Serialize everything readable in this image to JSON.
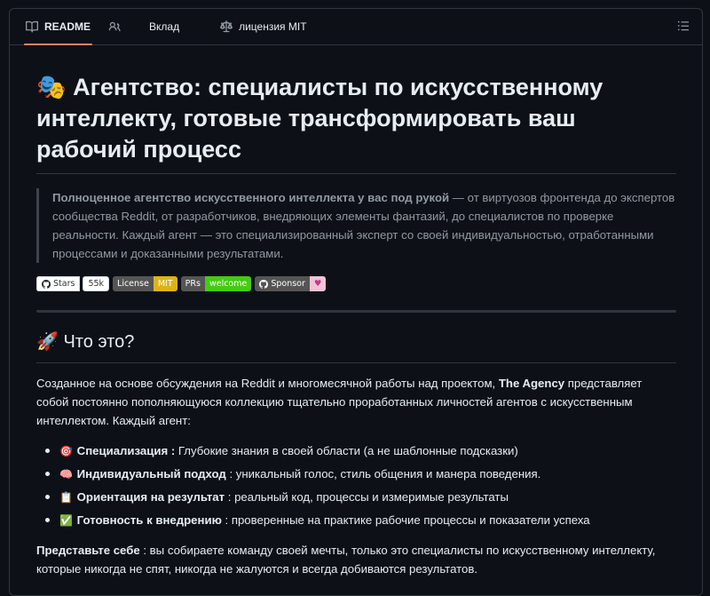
{
  "tabs": [
    {
      "label": "README",
      "icon": "book-icon",
      "active": true
    },
    {
      "label": "",
      "icon": "people-icon"
    },
    {
      "label": "Вклад",
      "icon": ""
    },
    {
      "label": "лицензия MIT",
      "icon": "law-icon"
    }
  ],
  "title": {
    "emoji": "🎭",
    "text": "Агентство: специалисты по искусственному интеллекту, готовые трансформировать ваш рабочий процесс"
  },
  "quote": {
    "bold": "Полноценное агентство искусственного интеллекта у вас под рукой",
    "text": " — от виртуозов фронтенда до экспертов сообщества Reddit, от разработчиков, внедряющих элементы фантазий, до специалистов по проверке реальности. Каждый агент — это специализированный эксперт со своей индивидуальностью, отработанными процессами и доказанными результатами."
  },
  "badges": {
    "stars_label": "Stars",
    "stars_count": "55k",
    "license_label": "License",
    "license_value": "MIT",
    "prs_label": "PRs",
    "prs_value": "welcome",
    "sponsor_label": "Sponsor",
    "sponsor_heart": "♥",
    "colors": {
      "mit": "#dfb317",
      "welcome": "#4c1",
      "heart_bg": "#f0c2d6",
      "heart": "#bf3989"
    }
  },
  "section": {
    "emoji": "🚀",
    "heading": "Что это?",
    "intro_before": "Созданное на основе обсуждения на Reddit и многомесячной работы над проектом, ",
    "intro_bold": "The Agency",
    "intro_after": " представляет собой постоянно пополняющуюся коллекцию тщательно проработанных личностей агентов с искусственным интеллектом. Каждый агент:",
    "items": [
      {
        "emoji": "🎯",
        "bold": "Специализация :",
        "text": " Глубокие знания в своей области (а не шаблонные подсказки)"
      },
      {
        "emoji": "🧠",
        "bold": "Индивидуальный подход",
        "text": " : уникальный голос, стиль общения и манера поведения."
      },
      {
        "emoji": "📋",
        "bold": "Ориентация на результат",
        "text": " : реальный код, процессы и измеримые результаты"
      },
      {
        "emoji": "✅",
        "bold": "Готовность к внедрению",
        "text": " : проверенные на практике рабочие процессы и показатели успеха"
      }
    ],
    "outro_bold": "Представьте себе",
    "outro_text": " : вы собираете команду своей мечты, только это специалисты по искусственному интеллекту, которые никогда не спят, никогда не жалуются и всегда добиваются результатов."
  },
  "accent": "#f78166"
}
